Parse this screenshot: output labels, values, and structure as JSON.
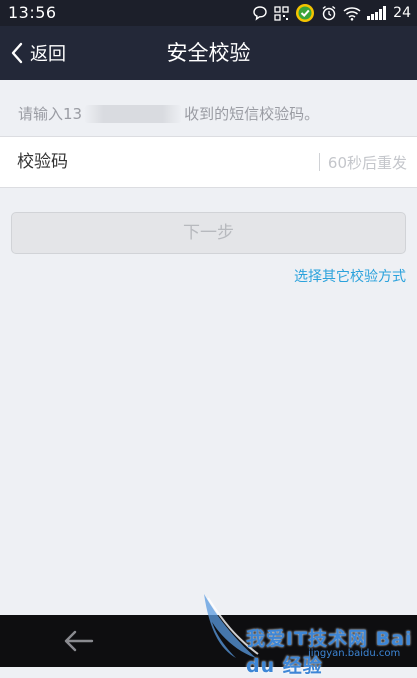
{
  "status_bar": {
    "time": "13:56",
    "battery": "24",
    "icons": [
      "chat-bubble-icon",
      "qr-scan-icon",
      "security-app-icon",
      "alarm-icon",
      "wifi-icon",
      "signal-icon"
    ]
  },
  "title_bar": {
    "back_label": "返回",
    "title": "安全校验"
  },
  "hint": {
    "prefix": "请输入13",
    "suffix": "收到的短信校验码。"
  },
  "code_field": {
    "label": "校验码",
    "value": "",
    "resend_label": "60秒后重发"
  },
  "next_button": {
    "label": "下一步"
  },
  "other_method_link": {
    "label": "选择其它校验方式"
  },
  "watermark": {
    "text": "我爱IT技术网 Bai du 经验",
    "url": "jingyan.baidu.com"
  },
  "colors": {
    "title_bar_bg": "#232838",
    "link": "#2ba2dc",
    "page_bg": "#eef0f4"
  }
}
